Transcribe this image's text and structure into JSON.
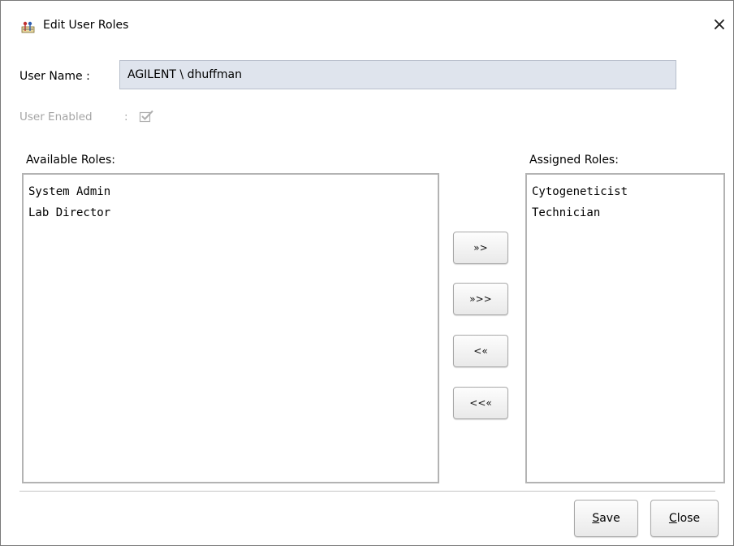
{
  "window": {
    "title": "Edit User Roles",
    "close_glyph": "×"
  },
  "user": {
    "name_label": "User Name :",
    "name_value": "AGILENT \\ dhuffman",
    "enabled_label": "User Enabled",
    "enabled_colon": ":",
    "enabled_checked": true
  },
  "available": {
    "label": "Available Roles:",
    "items": [
      "System Admin",
      "Lab Director"
    ]
  },
  "assigned": {
    "label": "Assigned Roles:",
    "items": [
      "Cytogeneticist",
      "Technician"
    ]
  },
  "move_buttons": {
    "add": "»>",
    "add_all": "»>>",
    "remove": "<«",
    "remove_all": "<<«"
  },
  "footer": {
    "save_mnemonic": "S",
    "save_rest": "ave",
    "close_mnemonic": "C",
    "close_rest": "lose"
  },
  "colors": {
    "field_bg": "#dfe4ed",
    "disabled_text": "#a5a5a5",
    "list_border": "#b3b3b3"
  }
}
